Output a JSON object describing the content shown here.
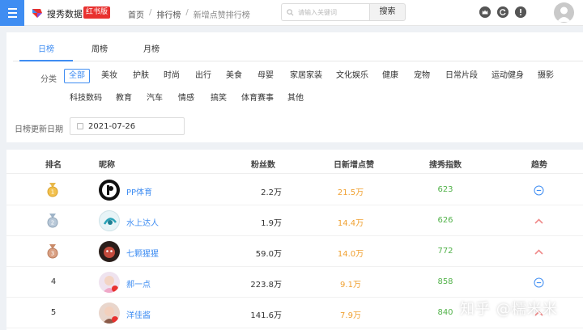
{
  "header": {
    "brand": "搜秀数据",
    "brand_badge": "红书版",
    "breadcrumb": [
      "首页",
      "排行榜",
      "新增点赞排行榜"
    ],
    "search_placeholder": "请输入关键词",
    "search_button": "搜索"
  },
  "tabs": [
    {
      "label": "日榜",
      "active": true
    },
    {
      "label": "周榜",
      "active": false
    },
    {
      "label": "月榜",
      "active": false
    }
  ],
  "category_label": "分类",
  "categories": [
    "全部",
    "美妆",
    "护肤",
    "时尚",
    "出行",
    "美食",
    "母婴",
    "家居家装",
    "文化娱乐",
    "健康",
    "宠物",
    "日常片段",
    "运动健身",
    "摄影",
    "科技数码",
    "教育",
    "汽车",
    "情感",
    "搞笑",
    "体育赛事",
    "其他"
  ],
  "date_label": "日榜更新日期",
  "date_value": "2021-07-26",
  "table": {
    "headers": [
      "排名",
      "昵称",
      "粉丝数",
      "日新增点赞",
      "搜秀指数",
      "趋势"
    ],
    "rows": [
      {
        "rank": "1",
        "name": "PP体育",
        "fans": "2.2万",
        "daily_likes": "21.5万",
        "index": "623",
        "trend": "flat"
      },
      {
        "rank": "2",
        "name": "水上达人",
        "fans": "1.9万",
        "daily_likes": "14.4万",
        "index": "626",
        "trend": "up"
      },
      {
        "rank": "3",
        "name": "七颗猩猩",
        "fans": "59.0万",
        "daily_likes": "14.0万",
        "index": "772",
        "trend": "up"
      },
      {
        "rank": "4",
        "name": "郝一点",
        "fans": "223.8万",
        "daily_likes": "9.1万",
        "index": "858",
        "trend": "flat"
      },
      {
        "rank": "5",
        "name": "洋佳酱",
        "fans": "141.6万",
        "daily_likes": "7.9万",
        "index": "840",
        "trend": "up"
      }
    ]
  },
  "watermark": "知乎 @糯米米",
  "colors": {
    "accent": "#3f8df2",
    "badge": "#e8312f",
    "likes": "#f0a030",
    "index": "#52b24a",
    "trend_up": "#f08a8a"
  }
}
